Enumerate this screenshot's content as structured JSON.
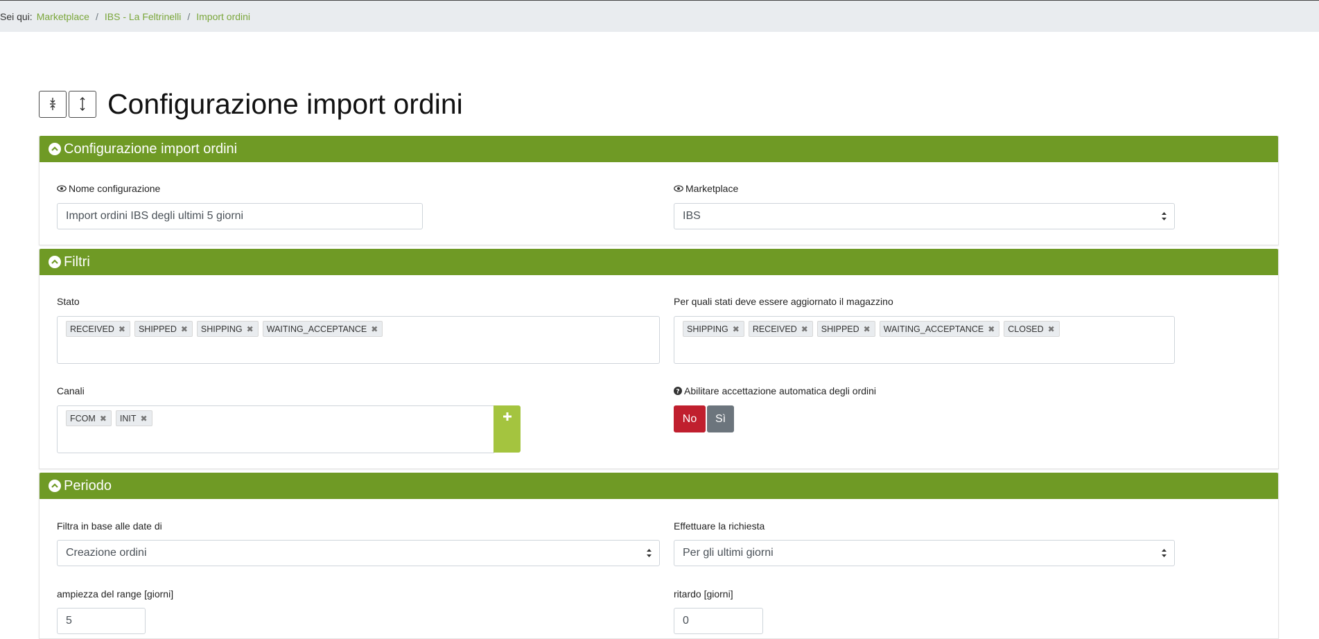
{
  "breadcrumb": {
    "prefix": "Sei qui:",
    "items": [
      "Marketplace",
      "IBS - La Feltrinelli",
      "Import ordini"
    ]
  },
  "page": {
    "title": "Configurazione import ordini",
    "expand_all_icon": "collapse-vertical-icon",
    "collapse_all_icon": "expand-vertical-icon"
  },
  "sections": {
    "config": {
      "title": "Configurazione import ordini",
      "nome_label": "Nome configurazione",
      "nome_value": "Import ordini IBS degli ultimi 5 giorni",
      "marketplace_label": "Marketplace",
      "marketplace_value": "IBS"
    },
    "filtri": {
      "title": "Filtri",
      "stato_label": "Stato",
      "stato_tags": [
        "RECEIVED",
        "SHIPPED",
        "SHIPPING",
        "WAITING_ACCEPTANCE"
      ],
      "magazzino_label": "Per quali stati deve essere aggiornato il magazzino",
      "magazzino_tags": [
        "SHIPPING",
        "RECEIVED",
        "SHIPPED",
        "WAITING_ACCEPTANCE",
        "CLOSED"
      ],
      "canali_label": "Canali",
      "canali_tags": [
        "FCOM",
        "INIT"
      ],
      "add_button_symbol": "+",
      "accettazione_label": "Abilitare accettazione automatica degli ordini",
      "toggle_no": "No",
      "toggle_si": "Sì"
    },
    "periodo": {
      "title": "Periodo",
      "filtra_label": "Filtra in base alle date di",
      "filtra_value": "Creazione ordini",
      "richiesta_label": "Effettuare la richiesta",
      "richiesta_value": "Per gli ultimi giorni",
      "ampiezza_label": "ampiezza del range [giorni]",
      "ampiezza_value": "5",
      "ritardo_label": "ritardo [giorni]",
      "ritardo_value": "0"
    }
  },
  "colors": {
    "accent": "#6f9a25",
    "link": "#7aa63a",
    "add_button": "#a4c43f",
    "danger": "#c01f2e",
    "secondary": "#6c757d"
  }
}
